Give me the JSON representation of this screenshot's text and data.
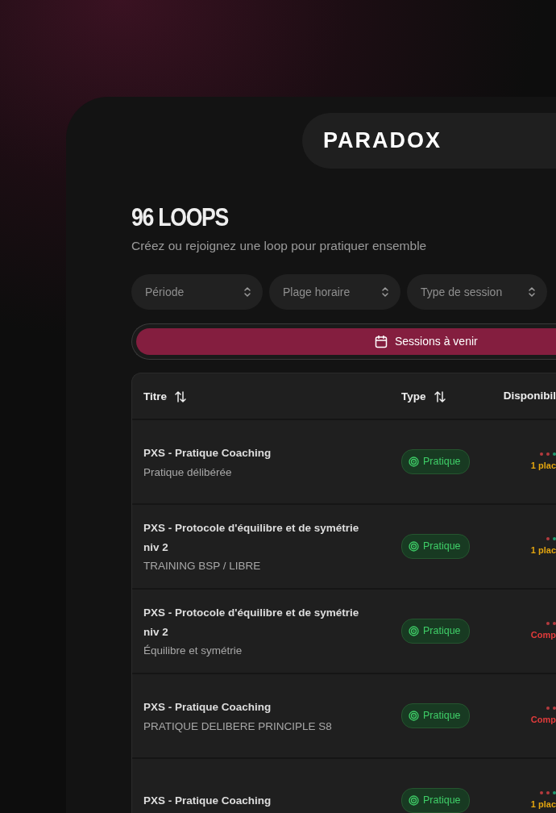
{
  "logo": "PARADOX",
  "heading": "96 LOOPS",
  "subtitle": "Créez ou rejoignez une loop pour pratiquer ensemble",
  "filters": [
    {
      "label": "Période"
    },
    {
      "label": "Plage horaire"
    },
    {
      "label": "Type de session"
    }
  ],
  "tabs": [
    {
      "label": "Sessions à venir",
      "selected": true
    }
  ],
  "table": {
    "columns": [
      {
        "label": "Titre",
        "sortable": true
      },
      {
        "label": "Type",
        "sortable": true
      },
      {
        "label": "Disponibil",
        "sortable": false
      }
    ],
    "rows": [
      {
        "title": "PXS - Pratique Coaching",
        "subtitle": "Pratique délibérée",
        "type": "Pratique",
        "dots": [
          {
            "color": "#b53a3e"
          },
          {
            "color": "#b53a3e"
          },
          {
            "color": "#1f9a70"
          }
        ],
        "availability": "1 plac",
        "color": "#e3a50f"
      },
      {
        "title": "PXS - Protocole d'équilibre et de symétrie niv 2",
        "subtitle": "TRAINING BSP / LIBRE",
        "type": "Pratique",
        "dots": [
          {
            "color": "#b53a3e"
          },
          {
            "color": "#1f9a70"
          }
        ],
        "availability": "1 plac",
        "color": "#e3a50f"
      },
      {
        "title": "PXS - Protocole d'équilibre et de symétrie niv 2",
        "subtitle": "Équilibre et symétrie",
        "type": "Pratique",
        "dots": [
          {
            "color": "#b53a3e"
          },
          {
            "color": "#b53a3e"
          }
        ],
        "availability": "Comp",
        "color": "#e23b3b"
      },
      {
        "title": "PXS - Pratique Coaching",
        "subtitle": "PRATIQUE DELIBERE PRINCIPLE S8",
        "type": "Pratique",
        "dots": [
          {
            "color": "#b53a3e"
          },
          {
            "color": "#b53a3e"
          }
        ],
        "availability": "Comp",
        "color": "#e23b3b"
      },
      {
        "title": "PXS - Pratique Coaching",
        "type": "Pratique",
        "dots": [
          {
            "color": "#b53a3e"
          },
          {
            "color": "#b53a3e"
          },
          {
            "color": "#1f9a70"
          }
        ],
        "availability": "1 plac",
        "color": "#e3a50f"
      }
    ]
  }
}
